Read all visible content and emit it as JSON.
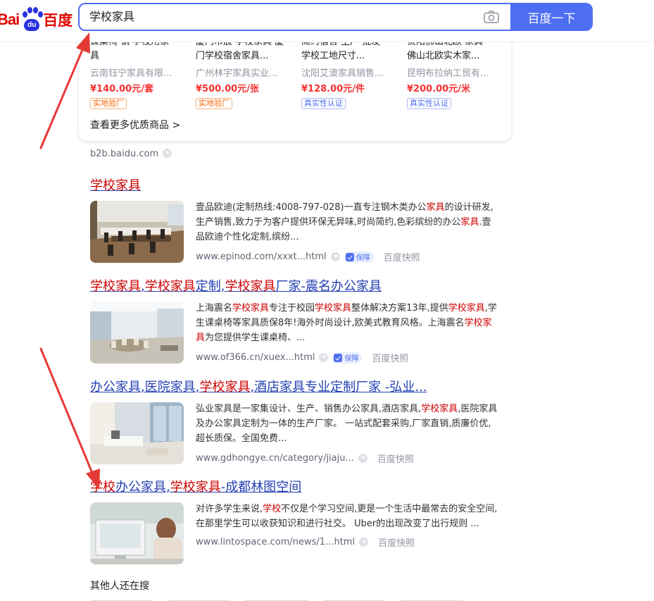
{
  "header": {
    "logo_bai": "Bai",
    "logo_paw": "du",
    "logo_cn": "百度",
    "search_value": "学校家具",
    "search_button": "百度一下"
  },
  "products": [
    {
      "title_line1": "课桌椅 钢 学校用家",
      "title_line2": "具",
      "seller": "云南钰宁家具有限...",
      "price": "¥140.00元/套",
      "badge": "实地验厂"
    },
    {
      "title_line1": "厦门市宸 学校家具 厦",
      "title_line2": "门学校宿舍家具...",
      "seller": "广州林宇家具实业...",
      "price": "¥500.00元/张",
      "badge": "实地验厂"
    },
    {
      "title_line1": "简约宿舍 生产 批发",
      "title_line2": "学校工地尺寸...",
      "seller": "沈阳艾澳家具销售...",
      "price": "¥128.00元/件",
      "badge": "真实性认证"
    },
    {
      "title_line1": "贵阳佛山北欧 家具",
      "title_line2": "佛山北欧实木家...",
      "seller": "昆明布拉纳工贸有...",
      "price": "¥200.00元/米",
      "badge": "真实性认证"
    }
  ],
  "see_more": "查看更多优质商品 >",
  "source": "b2b.baidu.com",
  "results": [
    {
      "title": "学校家具",
      "desc": [
        "壹品欧迪(定制热线:4008-797-028)一直专注钢木类办公",
        "家具",
        "的设计研发,生产销售,致力于为客户提供环保无异味,时尚简约,色彩缤纷的办公",
        "家具",
        ".壹品欧迪个性化定制,缤纷..."
      ],
      "url": "www.epinod.com/xxxt...html",
      "protect": "保障",
      "snapshot": "百度快照"
    },
    {
      "title_parts": [
        "学校家具",
        ",",
        "学校家具",
        "定制,",
        "学校家具",
        "厂家-震名办公家具"
      ],
      "desc": [
        "上海震名",
        "学校家具",
        "专注于校园",
        "学校家具",
        "整体解决方案13年,提供",
        "学校家具",
        ",学生课桌椅等家具质保8年!海外时尚设计,欧美式教育风格。上海震名",
        "学校家具",
        "为您提供学生课桌椅、..."
      ],
      "url": "www.of366.cn/xuex...html",
      "protect": "保障",
      "snapshot": "百度快照"
    },
    {
      "title_parts": [
        "办公家具,医院家具,",
        "学校家具",
        ",酒店家具专业定制厂家 -弘业..."
      ],
      "desc": [
        "弘业家具是一家集设计、生产、销售办公家具,酒店家具,",
        "学校家具",
        ",医院家具及办公家具定制为一体的生产厂家。 一站式配套采购,厂家直销,质廉价优,超长质保。全国免费..."
      ],
      "url": "www.gdhongye.cn/category/jiaju...",
      "snapshot": "百度快照"
    },
    {
      "title_parts": [
        "学校",
        "办公家具,",
        "学校家具",
        "-成都林图空间"
      ],
      "desc": [
        "对许多学生来说,",
        "学校",
        "不仅是个学习空间,更是一个生活中最常去的安全空间,在那里学生可以收获知识和进行社交。 Uber的出现改变了出行规则 ..."
      ],
      "url": "www.lintospace.com/news/1...html",
      "snapshot": "百度快照"
    }
  ],
  "others_title": "其他人还在搜",
  "colors": {
    "brand_blue": "#4e6ef2",
    "link_blue": "#2440b3",
    "highlight_red": "#cc0000",
    "price_red": "#f73131"
  }
}
